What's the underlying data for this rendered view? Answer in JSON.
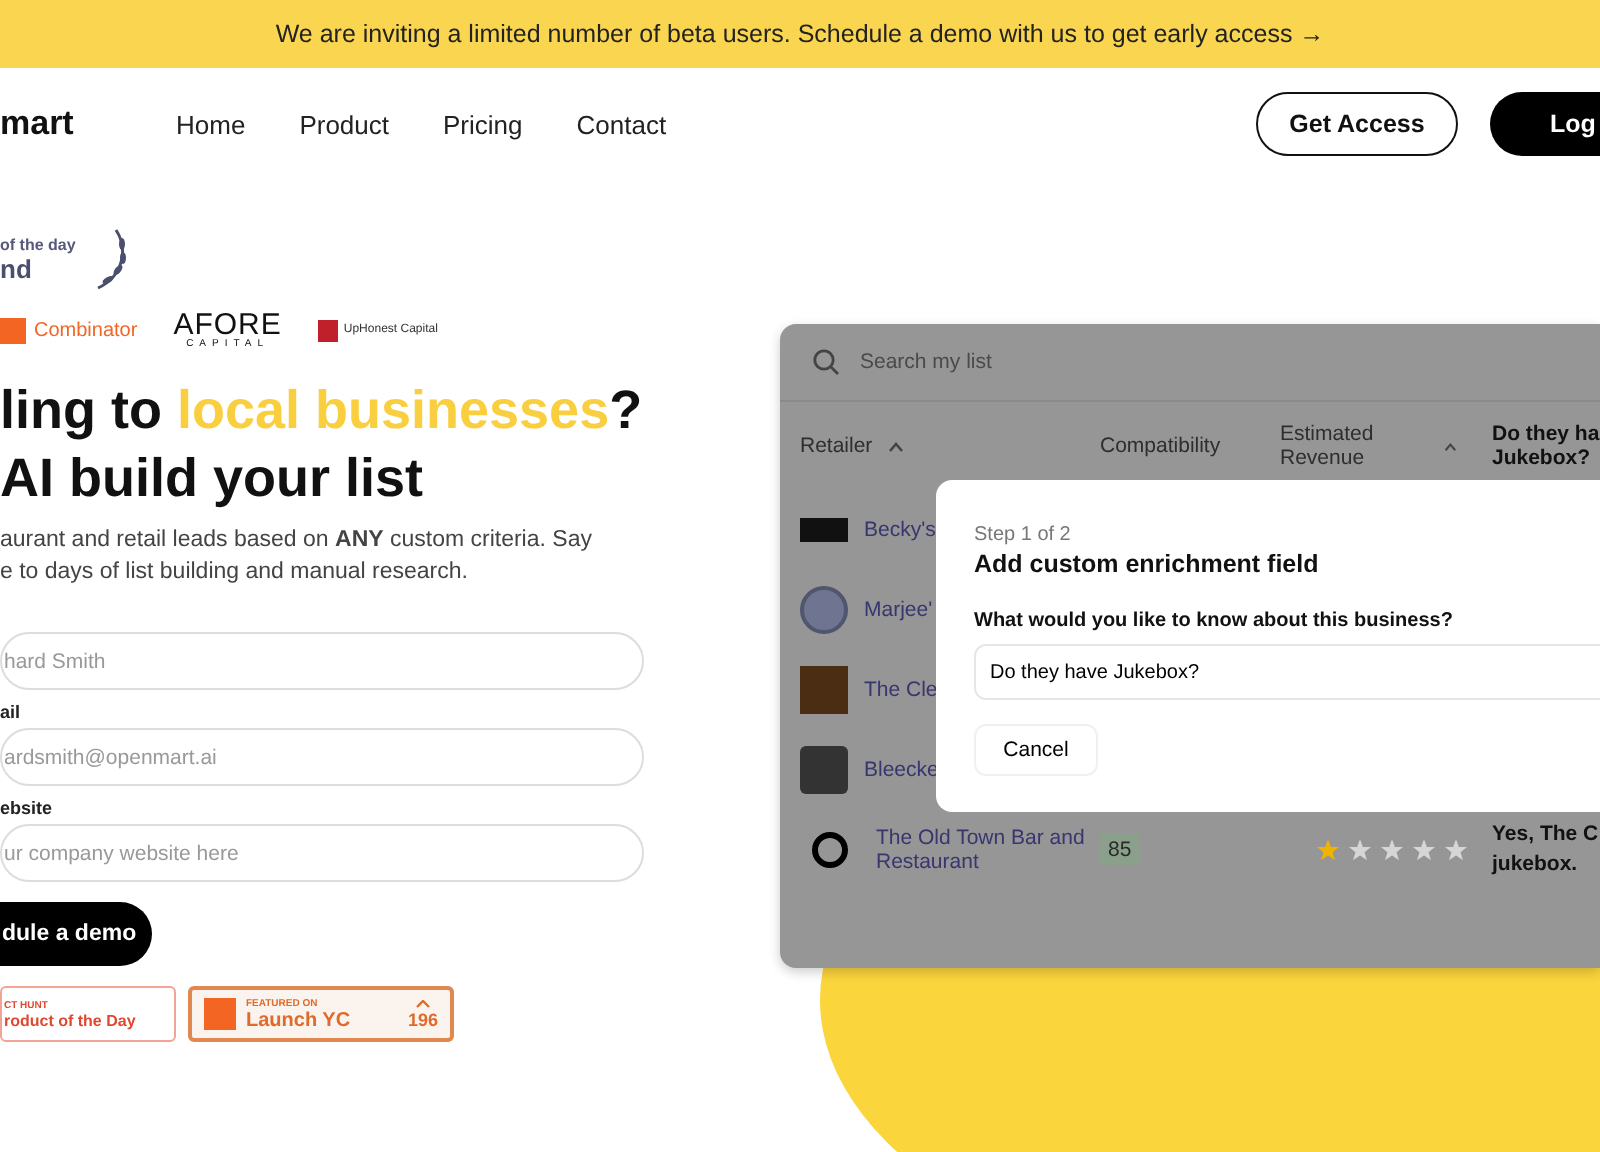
{
  "banner": {
    "text": "We are inviting a limited number of beta users. Schedule a demo with us to get early access →"
  },
  "nav": {
    "logo": "mart",
    "links": [
      {
        "label": "Home"
      },
      {
        "label": "Product"
      },
      {
        "label": "Pricing"
      },
      {
        "label": "Contact"
      }
    ],
    "buttons": [
      {
        "label": "Get Access",
        "kind": "outline"
      },
      {
        "label": "Log",
        "kind": "solid"
      }
    ]
  },
  "award": {
    "line1": "of the day",
    "line2": "nd"
  },
  "investors": [
    {
      "label": "Combinator",
      "kind": "yc"
    },
    {
      "label": "AFORE",
      "sub": "CAPITAL",
      "kind": "afore"
    },
    {
      "label": "UpHonest Capital",
      "kind": "uphonest"
    }
  ],
  "headline": {
    "before": "ling to ",
    "highlight": "local businesses",
    "after": "?",
    "line2": "AI build your list"
  },
  "subtitle": [
    "aurant and retail leads based on **ANY** custom criteria. Say",
    "e to days of list building and manual research."
  ],
  "fields": [
    {
      "placeholder": "hard Smith"
    },
    {
      "label": "ail",
      "placeholder": "ardsmith@openmart.ai"
    },
    {
      "label": "ebsite",
      "placeholder": "ur company website here"
    }
  ],
  "cta": "dule a demo",
  "badges": [
    {
      "kind": "producthunt",
      "small": "CT HUNT",
      "label": "roduct of the Day"
    },
    {
      "kind": "yc",
      "small": "FEATURED ON",
      "label": "Launch YC",
      "count": "196"
    }
  ],
  "mockup": {
    "search": {
      "placeholder": "Search my list"
    },
    "columns": [
      {
        "label": "Retailer",
        "sortable": true
      },
      {
        "label": "Compatibility",
        "sortable": false
      },
      {
        "label": "Estimated Revenue",
        "sortable": true
      },
      {
        "label": "Do they ha Jukebox?",
        "sortable": false
      }
    ],
    "rows": [
      {
        "name": "Becky's",
        "kind": "sign"
      },
      {
        "name": "Marjee'",
        "kind": "circle"
      },
      {
        "name": "The Cle",
        "kind": "square"
      },
      {
        "name": "Bleecke",
        "kind": "cube"
      },
      {
        "name": "The Old Town Bar and Restaurant",
        "kind": "ring",
        "score": "85",
        "stars": 1,
        "answer": "Yes, The C jukebox."
      }
    ],
    "modal": {
      "step": "Step 1 of 2",
      "title": "Add custom enrichment field",
      "question": "What would you like to know about this business?",
      "value": "Do they have Jukebox?",
      "cancel": "Cancel"
    }
  }
}
